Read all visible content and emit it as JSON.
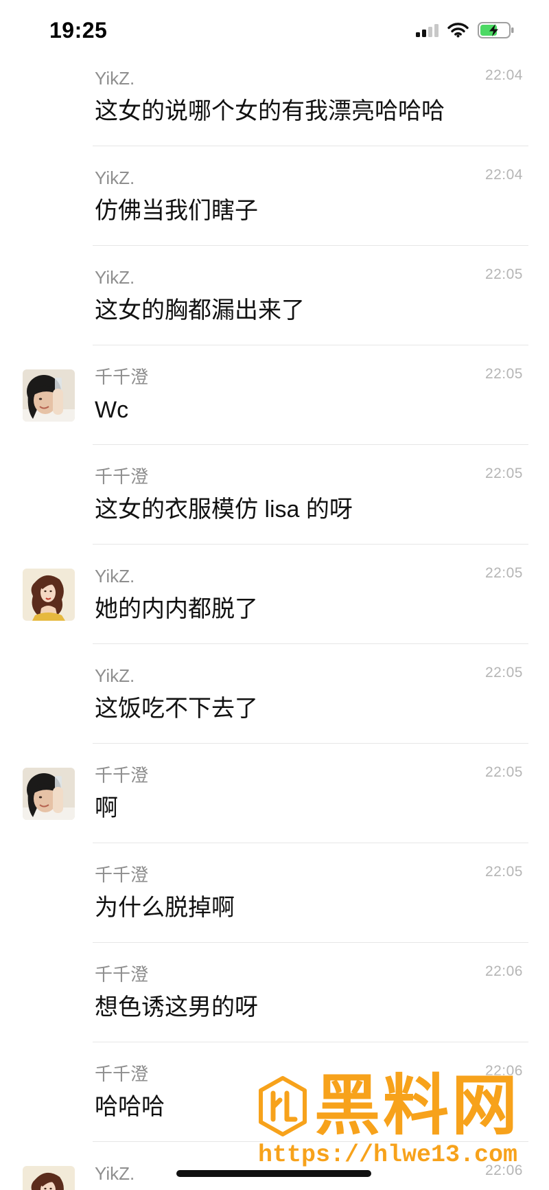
{
  "status_bar": {
    "time": "19:25",
    "signal_icon": "cellular-signal-icon",
    "signal_bars_active": 2,
    "wifi_icon": "wifi-icon",
    "battery_icon": "battery-charging-icon",
    "battery_level": 0.6
  },
  "messages": [
    {
      "sender": "YikZ.",
      "time": "22:04",
      "text": "这女的说哪个女的有我漂亮哈哈哈"
    },
    {
      "sender": "YikZ.",
      "time": "22:04",
      "text": "仿佛当我们瞎子"
    },
    {
      "sender": "YikZ.",
      "time": "22:05",
      "text": "这女的胸都漏出来了"
    },
    {
      "sender": "千千澄",
      "time": "22:05",
      "text": "Wc",
      "avatar": "girl-photo-avatar"
    },
    {
      "sender": "千千澄",
      "time": "22:05",
      "text": "这女的衣服模仿 lisa 的呀"
    },
    {
      "sender": "YikZ.",
      "time": "22:05",
      "text": "她的内内都脱了",
      "avatar": "princess-cartoon-avatar"
    },
    {
      "sender": "YikZ.",
      "time": "22:05",
      "text": "这饭吃不下去了"
    },
    {
      "sender": "千千澄",
      "time": "22:05",
      "text": "啊",
      "avatar": "girl-photo-avatar"
    },
    {
      "sender": "千千澄",
      "time": "22:05",
      "text": "为什么脱掉啊"
    },
    {
      "sender": "千千澄",
      "time": "22:06",
      "text": "想色诱这男的呀"
    },
    {
      "sender": "千千澄",
      "time": "22:06",
      "text": "哈哈哈"
    },
    {
      "sender": "YikZ.",
      "time": "22:06",
      "avatar": "princess-cartoon-avatar"
    }
  ],
  "watermark": {
    "logo_icon": "hexagon-logo-icon",
    "brand": "黑料网",
    "url": "https://hlwe13.com"
  },
  "colors": {
    "background": "#ffffff",
    "sender": "#8e8e8e",
    "time": "#b5b5b5",
    "text": "#111111",
    "divider": "#e6e6e6",
    "watermark": "#f7a21b",
    "battery_fill": "#4cd964"
  }
}
